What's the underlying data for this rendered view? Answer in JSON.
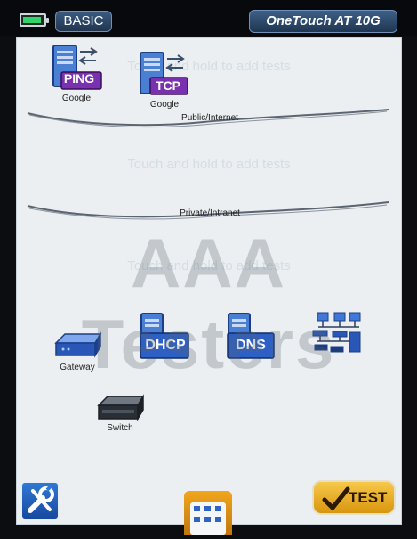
{
  "status_bar": {
    "battery_level": 0.9,
    "mode_label": "BASIC",
    "product_title": "OneTouch AT 10G"
  },
  "canvas": {
    "hint_text": "Touch and hold to add tests",
    "internet_tests": [
      {
        "badge": "PING",
        "label": "Google"
      },
      {
        "badge": "TCP",
        "label": "Google"
      }
    ],
    "public_cloud_label": "Public/Internet",
    "private_cloud_label": "Private/Intranet",
    "private_tests": [
      {
        "name": "gateway",
        "label": "Gateway"
      },
      {
        "name": "dhcp",
        "badge": "DHCP"
      },
      {
        "name": "dns",
        "badge": "DNS"
      },
      {
        "name": "network-discovery"
      }
    ],
    "switch_label": "Switch"
  },
  "watermark": "AAA Testers",
  "footer": {
    "test_button_label": "TEST"
  },
  "colors": {
    "accent_blue": "#2f63c6",
    "badge_purple": "#6f2aa6",
    "test_gold": "#f0b32b",
    "canvas_bg": "#eceff1"
  },
  "icons": {
    "tools": "tools-icon",
    "check": "check-icon",
    "battery": "battery-icon"
  }
}
